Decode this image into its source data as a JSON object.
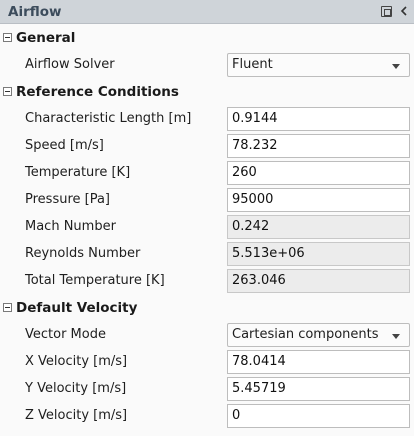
{
  "panel": {
    "title": "Airflow"
  },
  "icons": {
    "float": "float-window-icon",
    "collapse": "chevron-left-icon"
  },
  "general": {
    "header": "General",
    "airflow_solver": {
      "label": "Airflow Solver",
      "value": "Fluent"
    }
  },
  "reference": {
    "header": "Reference Conditions",
    "characteristic_length": {
      "label": "Characteristic Length [m]",
      "value": "0.9144"
    },
    "speed": {
      "label": "Speed [m/s]",
      "value": "78.232"
    },
    "temperature": {
      "label": "Temperature [K]",
      "value": "260"
    },
    "pressure": {
      "label": "Pressure [Pa]",
      "value": "95000"
    },
    "mach": {
      "label": "Mach Number",
      "value": "0.242"
    },
    "reynolds": {
      "label": "Reynolds Number",
      "value": "5.513e+06"
    },
    "total_temperature": {
      "label": "Total Temperature [K]",
      "value": "263.046"
    }
  },
  "velocity": {
    "header": "Default Velocity",
    "vector_mode": {
      "label": "Vector Mode",
      "value": "Cartesian components"
    },
    "x": {
      "label": "X Velocity [m/s]",
      "value": "78.0414"
    },
    "y": {
      "label": "Y Velocity [m/s]",
      "value": "5.45719"
    },
    "z": {
      "label": "Z Velocity [m/s]",
      "value": "0"
    }
  }
}
